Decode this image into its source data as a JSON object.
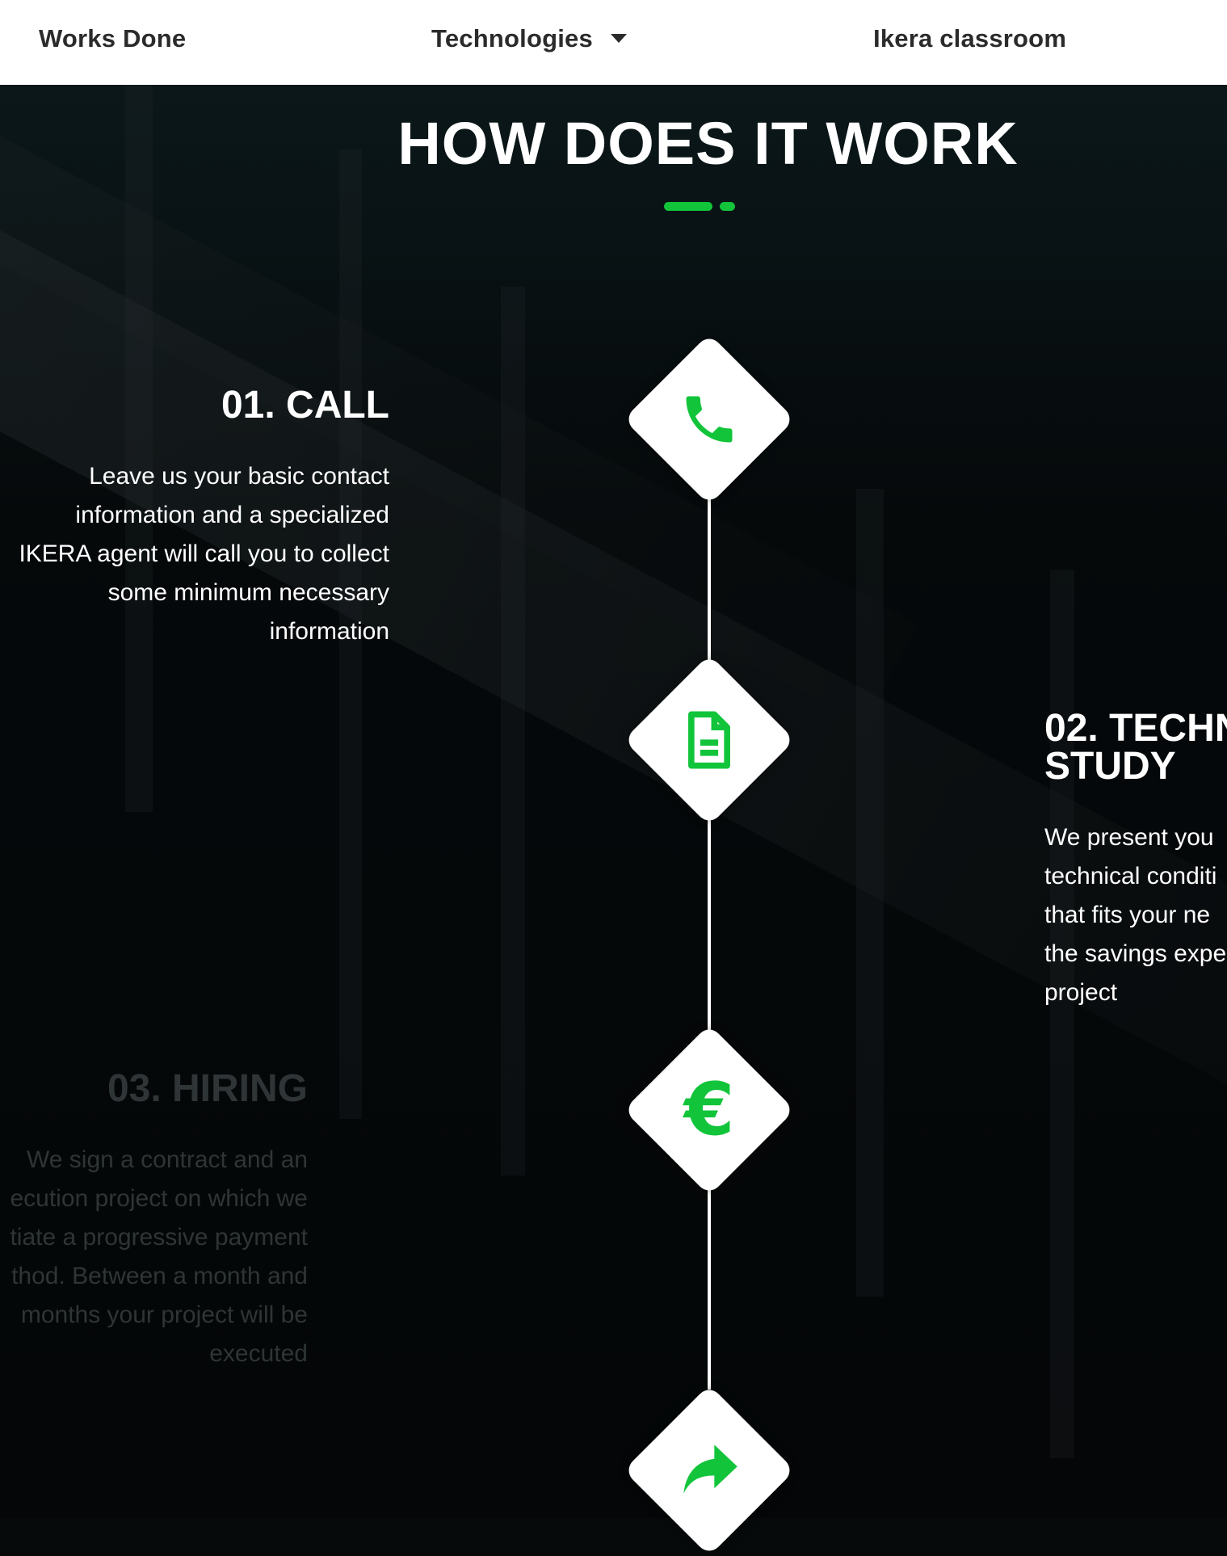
{
  "nav": {
    "works_done": "Works Done",
    "technologies": "Technologies",
    "ikera_classroom": "Ikera classroom"
  },
  "section": {
    "title": "HOW DOES IT WORK"
  },
  "steps": [
    {
      "title": "01. CALL",
      "icon": "phone-icon",
      "lines": [
        "Leave us your basic contact",
        "information and a specialized",
        "IKERA agent will call you to collect",
        "some minimum necessary",
        "information"
      ]
    },
    {
      "title_line1": "02. TECHN",
      "title_line2": "STUDY",
      "icon": "document-icon",
      "lines": [
        "We present you",
        "technical conditi",
        "that fits your ne",
        "the savings expe",
        "project"
      ]
    },
    {
      "title": "03. HIRING",
      "icon": "euro-icon",
      "euro_symbol": "€",
      "lines": [
        "We sign a contract and an",
        "ecution project on which we",
        "tiate a progressive payment",
        "thod. Between a month and",
        "months your project will be",
        "executed"
      ]
    },
    {
      "icon": "share-arrow-icon"
    }
  ],
  "colors": {
    "accent_green": "#12c43a",
    "nav_bg": "#ffffff",
    "nav_text": "#2b2b2b",
    "section_bg": "#070a0b"
  }
}
